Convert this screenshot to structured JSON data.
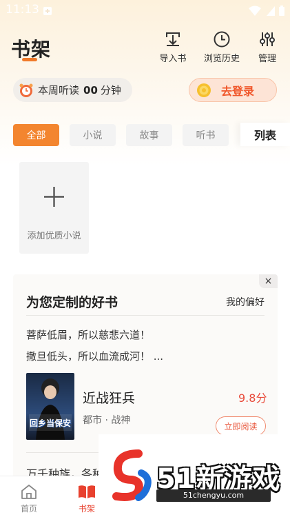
{
  "status_bar": {
    "time": "11:13"
  },
  "header": {
    "title": "书架",
    "tools": [
      {
        "label": "导入书",
        "icon": "import-book-icon"
      },
      {
        "label": "浏览历史",
        "icon": "history-clock-icon"
      },
      {
        "label": "管理",
        "icon": "manage-sliders-icon"
      }
    ]
  },
  "listen": {
    "label": "本周听读",
    "value": "00",
    "unit": "分钟"
  },
  "login": {
    "label": "去登录"
  },
  "tabs": [
    {
      "label": "全部",
      "active": true
    },
    {
      "label": "小说",
      "active": false
    },
    {
      "label": "故事",
      "active": false
    },
    {
      "label": "听书",
      "active": false
    }
  ],
  "list_toggle": "列表",
  "add_tile": {
    "label": "添加优质小说"
  },
  "recommend": {
    "close": "×",
    "title": "为您定制的好书",
    "preference": "我的偏好",
    "quote_lines": [
      "菩萨低眉，所以慈悲六道！",
      "撒旦低头，所以血流成河！ ..."
    ],
    "book": {
      "title": "近战狂兵",
      "score": "9.8分",
      "tags": "都市 · 战神",
      "read_label": "立即阅读",
      "cover_text": "回乡当保安"
    },
    "next_quote": "万千种族，各种"
  },
  "bottom_nav": [
    {
      "label": "首页",
      "icon": "home-icon",
      "active": false
    },
    {
      "label": "书架",
      "icon": "bookshelf-icon",
      "active": true
    }
  ],
  "watermark": {
    "text": "51新游戏",
    "url": "51chengyu.com"
  },
  "colors": {
    "accent": "#f3852f",
    "score": "#e84a3a",
    "login_text": "#f0562a"
  }
}
